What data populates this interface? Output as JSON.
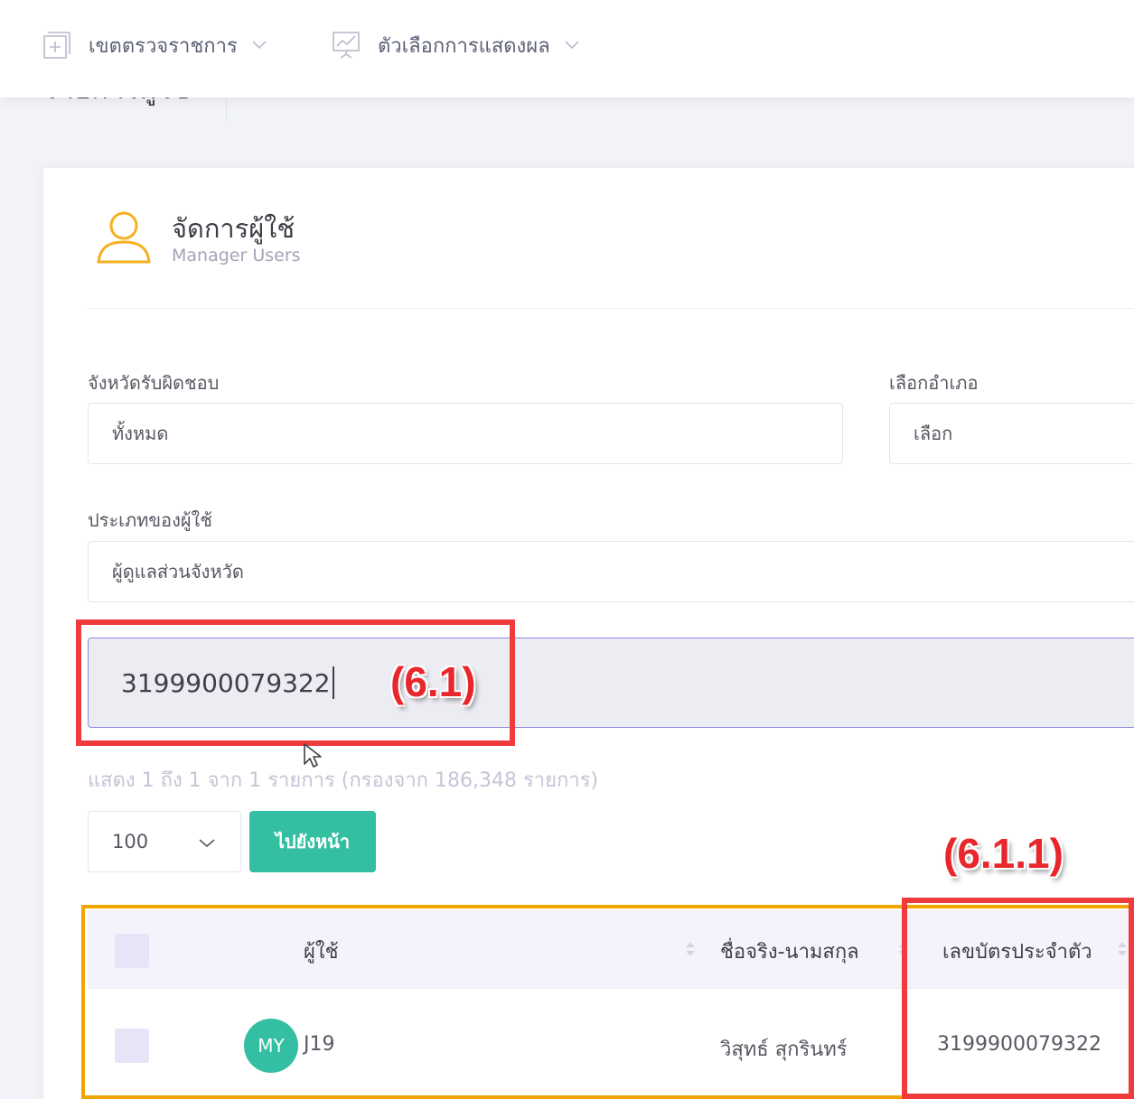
{
  "topnav": {
    "items": [
      {
        "label": "เขตตรวจราชการ",
        "icon": "plus-square-icon"
      },
      {
        "label": "ตัวเลือกการแสดงผล",
        "icon": "presentation-chart-icon"
      }
    ]
  },
  "subheader": {
    "title": "รายการผู้ใช้"
  },
  "card": {
    "icon": "user-outline-icon",
    "title": "จัดการผู้ใช้",
    "subtitle": "Manager Users"
  },
  "filters": {
    "province_label": "จังหวัดรับผิดชอบ",
    "province_value": "ทั้งหมด",
    "district_label": "เลือกอำเภอ",
    "district_value": "เลือก",
    "user_type_label": "ประเภทของผู้ใช้",
    "user_type_value": "ผู้ดูแลส่วนจังหวัด"
  },
  "search": {
    "value": "3199900079322"
  },
  "table_info": "แสดง 1 ถึง 1 จาก 1 รายการ (กรองจาก 186,348 รายการ)",
  "pagination": {
    "page_size": "100",
    "go_button": "ไปยังหน้า"
  },
  "table": {
    "columns": [
      "ผู้ใช้",
      "ชื่อจริง-นามสกุล",
      "เลขบัตรประจำตัว"
    ],
    "rows": [
      {
        "avatar": "MY",
        "user": "J19",
        "full_name": "วิสุทธ์ สุกรินทร์",
        "id_card": "3199900079322"
      }
    ]
  },
  "annotations": {
    "search_label": "(6.1)",
    "id_column_label": "(6.1.1)"
  },
  "colors": {
    "accent_green": "#34bfa3",
    "highlight_red": "#ef3b3b",
    "highlight_orange": "#f0a500",
    "search_border": "#8b86e0"
  }
}
